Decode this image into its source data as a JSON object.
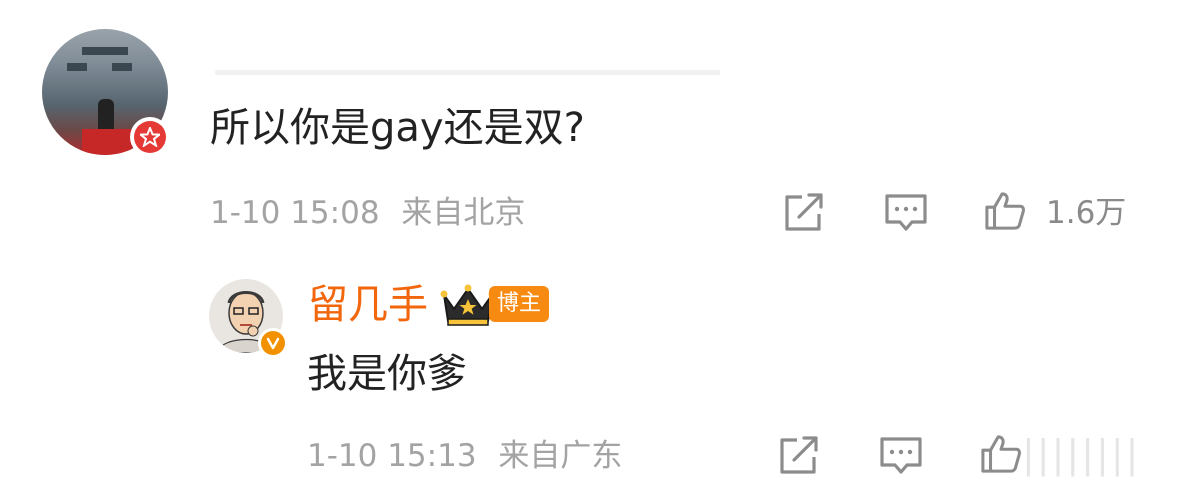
{
  "comment": {
    "text": "所以你是gay还是双?",
    "time": "1-10 15:08",
    "location": "来自北京",
    "like_count": "1.6万",
    "avatar_badge_icon": "red-star-badge-icon",
    "actions": {
      "share_icon": "share-icon",
      "comment_icon": "comment-icon",
      "like_icon": "thumbs-up-icon"
    }
  },
  "reply": {
    "author": "留几手",
    "author_tag": "博主",
    "crown_icon": "crown-icon",
    "verified_badge": "v-verified-icon",
    "text": "我是你爹",
    "time": "1-10 15:13",
    "location": "来自广东",
    "actions": {
      "share_icon": "share-icon",
      "comment_icon": "comment-icon",
      "like_icon": "thumbs-up-icon"
    }
  },
  "colors": {
    "author_name": "#f2660c",
    "author_tag_bg": "#f78a10",
    "meta_text": "#a3a3a3",
    "badge_red": "#e53935",
    "badge_orange": "#f29100"
  }
}
